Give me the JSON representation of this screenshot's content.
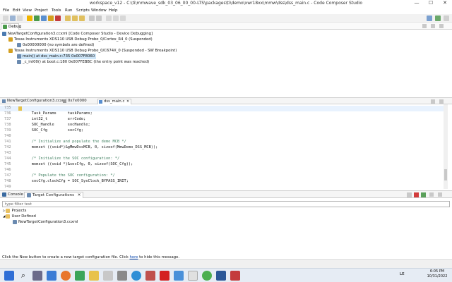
{
  "window": {
    "title": "workspace_v12 - C:\\ti\\mmwave_sdk_03_06_00_00-LTS\\packages\\ti\\demo\\xwr18xx\\mmw\\dss\\dss_main.c - Code Composer Studio",
    "minimize": "—",
    "maximize": "☐",
    "close": "✕"
  },
  "menu": [
    "File",
    "Edit",
    "View",
    "Project",
    "Tools",
    "Run",
    "Scripts",
    "Window",
    "Help"
  ],
  "debug": {
    "tab_label": "Debug",
    "tree": [
      {
        "text": "NewTargetConfiguration3.ccxml [Code Composer Studio - Device Debugging]",
        "level": 0
      },
      {
        "text": "Texas Instruments XDS110 USB Debug Probe_0/Cortex_R4_0 (Suspended)",
        "level": 1
      },
      {
        "text": "0x00000000  (no symbols are defined)",
        "level": 2
      },
      {
        "text": "Texas Instruments XDS110 USB Debug Probe_0/C674X_0 (Suspended - SW Breakpoint)",
        "level": 1
      },
      {
        "text": "main() at dss_main.c:735 0x007F8060",
        "level": 2,
        "selected": true
      },
      {
        "text": "_c_int00() at boot.c:180 0x007FEBBC  (the entry point was reached)",
        "level": 2
      }
    ]
  },
  "editor": {
    "tabs": [
      {
        "label": "NewTargetConfiguration3.ccxml"
      },
      {
        "label": "0x7e0000"
      },
      {
        "label": "dss_main.c",
        "active": true
      }
    ],
    "lines": [
      {
        "num": "735",
        "text": ""
      },
      {
        "num": "736",
        "text": "    Task_Params     taskParams;"
      },
      {
        "num": "737",
        "text": "    int32_t         errCode;"
      },
      {
        "num": "738",
        "text": "    SOC_Handle      socHandle;"
      },
      {
        "num": "739",
        "text": "    SOC_Cfg         socCfg;"
      },
      {
        "num": "740",
        "text": ""
      },
      {
        "num": "741",
        "text": "    /* Initialize and populate the demo MCB */",
        "comment": true
      },
      {
        "num": "742",
        "text": "    memset ((void*)&gMmwDssMCB, 0, sizeof(MmwDemo_DSS_MCB));"
      },
      {
        "num": "743",
        "text": ""
      },
      {
        "num": "744",
        "text": "    /* Initialize the SOC configuration: */",
        "comment": true
      },
      {
        "num": "745",
        "text": "    memset ((void *)&socCfg, 0, sizeof(SOC_Cfg));"
      },
      {
        "num": "746",
        "text": ""
      },
      {
        "num": "747",
        "text": "    /* Populate the SOC configuration: */",
        "comment": true
      },
      {
        "num": "748",
        "text": "    socCfg.clockCfg = SOC_SysClock_BYPASS_INIT;"
      },
      {
        "num": "749",
        "text": ""
      }
    ]
  },
  "bottom": {
    "console_tab": "Console",
    "target_tab": "Target Configurations",
    "filter_placeholder": "type filter text",
    "tree": [
      {
        "text": "Projects",
        "level": 0
      },
      {
        "text": "User Defined",
        "level": 0
      },
      {
        "text": "NewTargetConfiguration3.ccxml",
        "level": 1
      }
    ],
    "status_prefix": "Click the New button to create a new target configuration file. Click ",
    "status_link": "here",
    "status_suffix": " to hide this message."
  },
  "taskbar": {
    "search_icon": "⌕",
    "lang": "LE",
    "time": "6:05 PM",
    "date": "10/31/2022"
  }
}
